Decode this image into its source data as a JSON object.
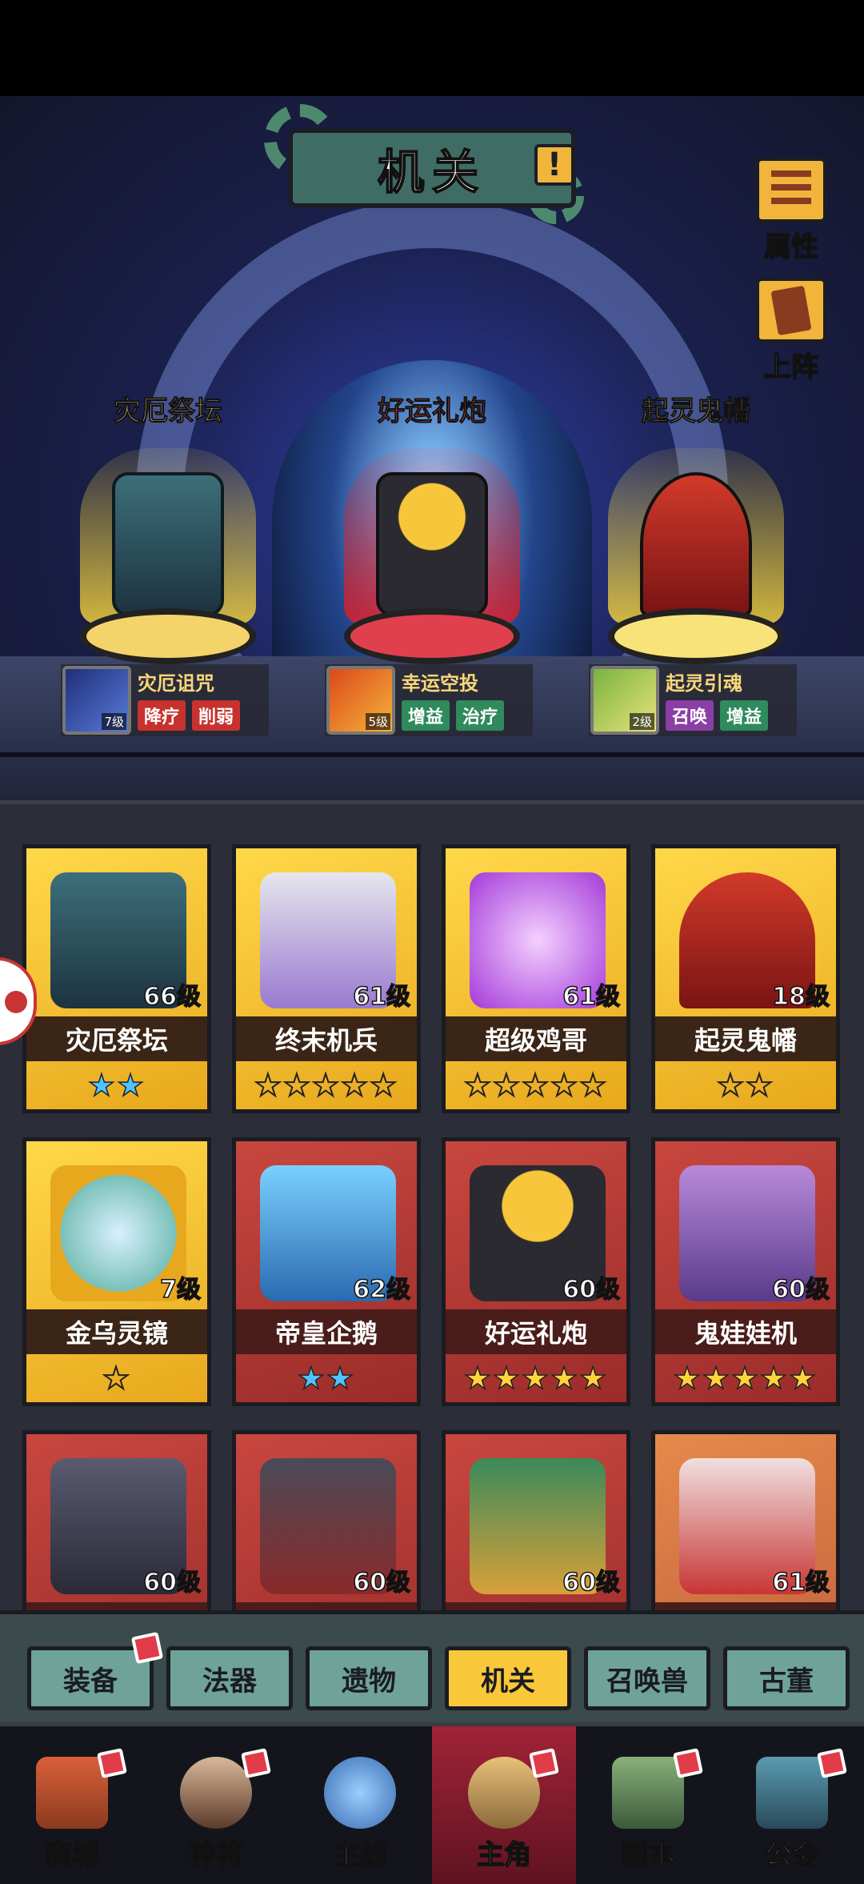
{
  "header": {
    "title": "机关",
    "alert": "!"
  },
  "side_buttons": [
    {
      "label": "属性",
      "icon": "list-icon"
    },
    {
      "label": "上阵",
      "icon": "card-icon"
    }
  ],
  "featured": [
    {
      "name": "灾厄祭坛",
      "name_color": "#f4d36a",
      "skill": {
        "name": "灾厄诅咒",
        "level": "7级",
        "tags": [
          "降疗",
          "削弱"
        ]
      }
    },
    {
      "name": "好运礼炮",
      "name_color": "#ff5a5a",
      "skill": {
        "name": "幸运空投",
        "level": "5级",
        "tags": [
          "增益",
          "治疗"
        ]
      }
    },
    {
      "name": "起灵鬼幡",
      "name_color": "#f4d36a",
      "skill": {
        "name": "起灵引魂",
        "level": "2级",
        "tags": [
          "召唤",
          "增益"
        ]
      }
    }
  ],
  "cards": [
    {
      "name": "灾厄祭坛",
      "level": "66级",
      "stars": "★★",
      "star_color": "blue"
    },
    {
      "name": "终末机兵",
      "level": "61级",
      "stars": "★★★★★",
      "star_color": "empty"
    },
    {
      "name": "超级鸡哥",
      "level": "61级",
      "stars": "★★★★★",
      "star_color": "empty"
    },
    {
      "name": "起灵鬼幡",
      "level": "18级",
      "stars": "★★",
      "star_color": "empty"
    },
    {
      "name": "金乌灵镜",
      "level": "7级",
      "stars": "★",
      "star_color": "empty"
    },
    {
      "name": "帝皇企鹅",
      "level": "62级",
      "stars": "★★",
      "star_color": "blue"
    },
    {
      "name": "好运礼炮",
      "level": "60级",
      "stars": "★★★★★",
      "star_color": "gold"
    },
    {
      "name": "鬼娃娃机",
      "level": "60级",
      "stars": "★★★★★",
      "star_color": "gold"
    },
    {
      "name": "",
      "level": "60级",
      "stars": "",
      "star_color": ""
    },
    {
      "name": "",
      "level": "60级",
      "stars": "",
      "star_color": ""
    },
    {
      "name": "",
      "level": "60级",
      "stars": "",
      "star_color": ""
    },
    {
      "name": "",
      "level": "61级",
      "stars": "",
      "star_color": ""
    }
  ],
  "category_tabs": [
    {
      "label": "装备",
      "badge": true
    },
    {
      "label": "法器",
      "badge": false
    },
    {
      "label": "遗物",
      "badge": false
    },
    {
      "label": "机关",
      "badge": false,
      "active": true
    },
    {
      "label": "召唤兽",
      "badge": false
    },
    {
      "label": "古董",
      "badge": false
    }
  ],
  "bottom_nav": [
    {
      "label": "商城",
      "icon": "shop-icon",
      "badge": true
    },
    {
      "label": "神将",
      "icon": "hero-icon",
      "badge": true
    },
    {
      "label": "主线",
      "icon": "swords-icon",
      "badge": false
    },
    {
      "label": "主角",
      "icon": "character-icon",
      "badge": true,
      "active": true
    },
    {
      "label": "副本",
      "icon": "dungeon-icon",
      "badge": true
    },
    {
      "label": "公会",
      "icon": "guild-icon",
      "badge": true
    }
  ]
}
